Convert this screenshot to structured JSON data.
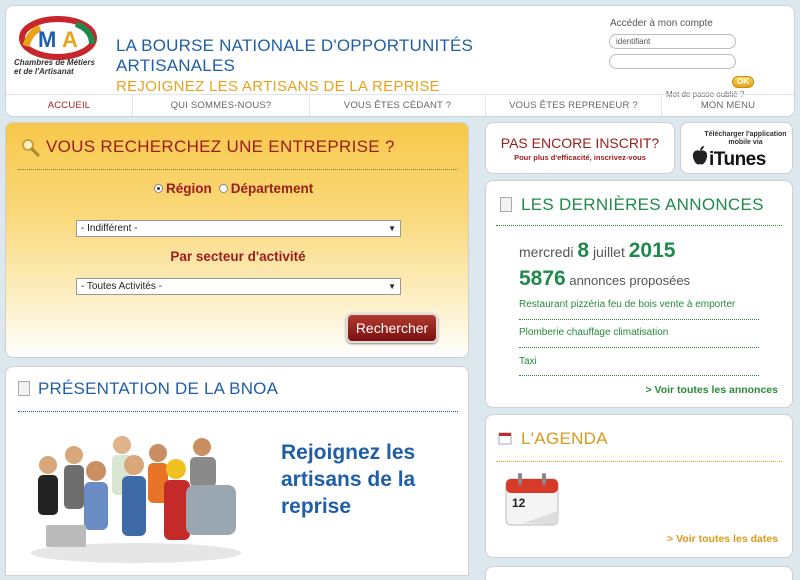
{
  "header": {
    "logo_sub": "Chambres de Métiers et de l'Artisanat",
    "title": "LA BOURSE NATIONALE D'OPPORTUNITÉS ARTISANALES",
    "subtitle": "REJOIGNEZ LES ARTISANS DE LA REPRISE"
  },
  "account": {
    "title": "Accéder à mon compte",
    "login_value": "identifiant",
    "password_value": "",
    "ok_label": "OK",
    "forgot_label": "Mot de passe oublié ?"
  },
  "nav": {
    "items": [
      {
        "label": "ACCUEIL"
      },
      {
        "label": "QUI SOMMES-NOUS?"
      },
      {
        "label": "VOUS ÊTES CÉDANT ?"
      },
      {
        "label": "VOUS ÊTES REPRENEUR ?"
      },
      {
        "label": "MON MENU"
      }
    ]
  },
  "search": {
    "title": "VOUS RECHERCHEZ UNE ENTREPRISE ?",
    "radio_region": "Région",
    "radio_departement": "Département",
    "selected_radio": "Région",
    "region_select": "- Indifférent -",
    "sector_label": "Par secteur d'activité",
    "sector_select": "- Toutes Activités -",
    "button_label": "Rechercher"
  },
  "presentation": {
    "title": "PRÉSENTATION DE LA BNOA",
    "tagline": "Rejoignez les artisans de la reprise"
  },
  "inscrit": {
    "title": "PAS ENCORE INSCRIT?",
    "subtitle": "Pour plus d'efficacité, inscrivez-vous"
  },
  "itunes": {
    "small_label": "Télécharger l'application mobile via",
    "big_label": "iTunes"
  },
  "annonces": {
    "title": "LES DERNIÈRES ANNONCES",
    "day_name": "mercredi",
    "day_num": "8",
    "month": "juillet",
    "year": "2015",
    "count": "5876",
    "count_label": "annonces proposées",
    "items": [
      {
        "label": "Restaurant pizzéria feu de bois vente à emporter"
      },
      {
        "label": "Plomberie chauffage climatisation"
      },
      {
        "label": "Taxi"
      }
    ],
    "see_all": "> Voir toutes les annonces"
  },
  "agenda": {
    "title": "L'AGENDA",
    "calendar_day": "12",
    "see_all": "> Voir toutes les dates"
  },
  "colors": {
    "brand_blue": "#1f5fa8",
    "brand_red": "#9c1b1b",
    "brand_orange": "#e8a31b",
    "brand_green": "#1f8a4c"
  }
}
